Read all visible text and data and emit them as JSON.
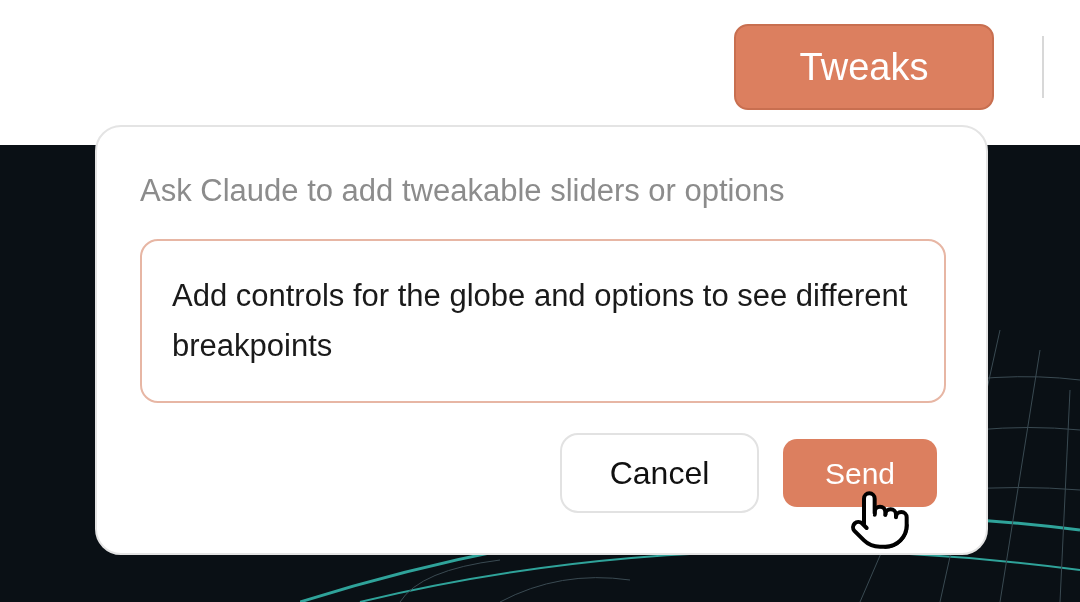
{
  "toolbar": {
    "tweaks_button": "Tweaks"
  },
  "popup": {
    "prompt": "Ask Claude to add tweakable sliders or options",
    "input": {
      "value": "Add controls for the globe and options to see different breakpoints"
    },
    "buttons": [
      {
        "label": "Cancel",
        "kind": "secondary"
      },
      {
        "label": "Send",
        "kind": "primary"
      }
    ]
  }
}
